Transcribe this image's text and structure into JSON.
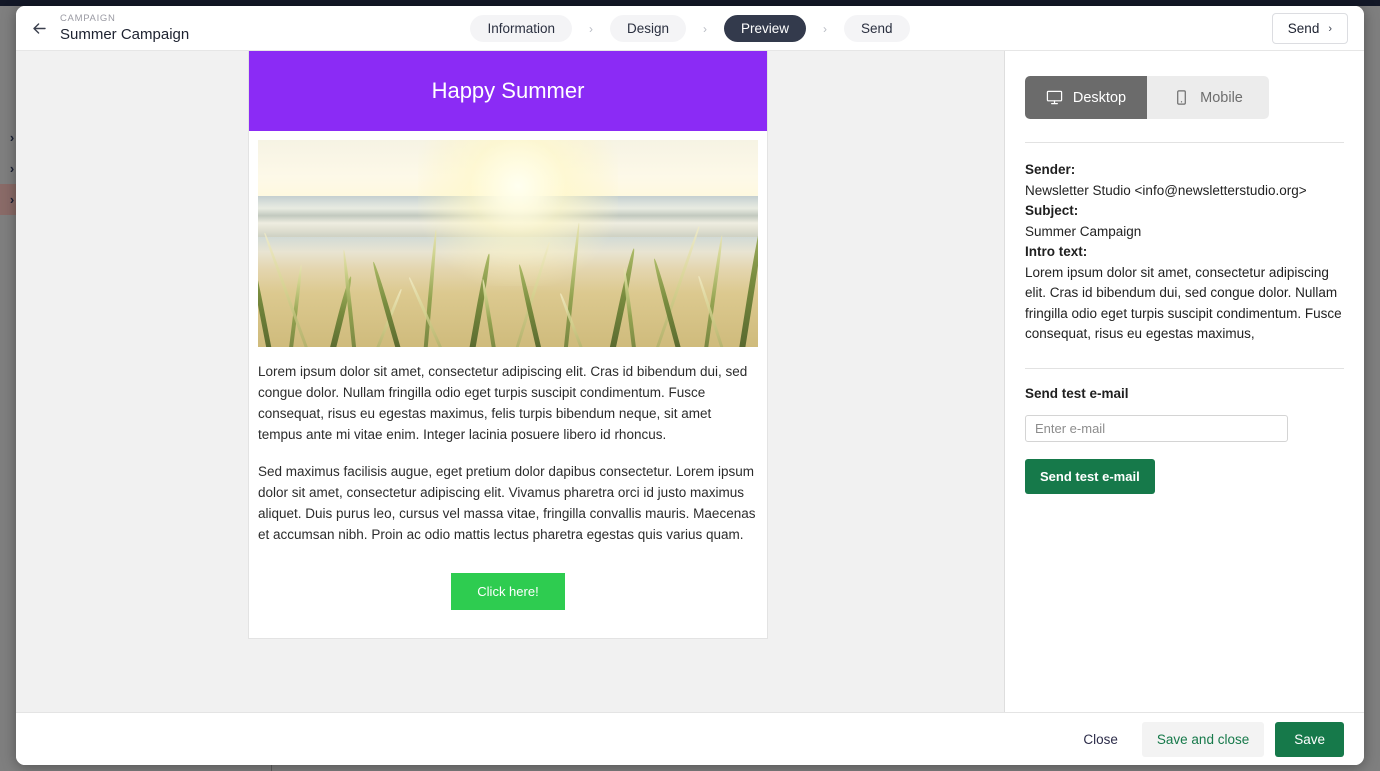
{
  "background": {
    "nav_chevrons": [
      "chevron-right-icon",
      "chevron-right-icon",
      "chevron-right-icon"
    ]
  },
  "header": {
    "back_icon": "arrow-left-icon",
    "kicker": "CAMPAIGN",
    "title": "Summer Campaign",
    "steps": [
      {
        "label": "Information",
        "active": false
      },
      {
        "label": "Design",
        "active": false
      },
      {
        "label": "Preview",
        "active": true
      },
      {
        "label": "Send",
        "active": false
      }
    ],
    "step_separator": "›",
    "send_button": {
      "label": "Send",
      "chevron": "›"
    }
  },
  "email_preview": {
    "banner_title": "Happy Summer",
    "banner_color": "#8b2bf5",
    "image_alt": "beach-sunset-dune-grass-photo",
    "paragraphs": [
      "Lorem ipsum dolor sit amet, consectetur adipiscing elit. Cras id bibendum dui, sed congue dolor. Nullam fringilla odio eget turpis suscipit condimentum. Fusce consequat, risus eu egestas maximus, felis turpis bibendum neque, sit amet tempus ante mi vitae enim. Integer lacinia posuere libero id rhoncus.",
      "Sed maximus facilisis augue, eget pretium dolor dapibus consectetur. Lorem ipsum dolor sit amet, consectetur adipiscing elit. Vivamus pharetra orci id justo maximus aliquet. Duis purus leo, cursus vel massa vitae, fringilla convallis mauris. Maecenas et accumsan nibh. Proin ac odio mattis lectus pharetra egestas quis varius quam."
    ],
    "cta_label": "Click here!",
    "cta_color": "#2ecc50"
  },
  "side_panel": {
    "device_toggle": [
      {
        "label": "Desktop",
        "icon": "monitor-icon",
        "active": true
      },
      {
        "label": "Mobile",
        "icon": "phone-icon",
        "active": false
      }
    ],
    "sender_label": "Sender:",
    "sender_value": "Newsletter Studio <info@newsletterstudio.org>",
    "subject_label": "Subject:",
    "subject_value": "Summer Campaign",
    "intro_label": "Intro text:",
    "intro_value": "Lorem ipsum dolor sit amet, consectetur adipiscing elit. Cras id bibendum dui, sed congue dolor. Nullam fringilla odio eget turpis suscipit condimentum. Fusce consequat, risus eu egestas maximus,",
    "send_test_title": "Send test e-mail",
    "email_placeholder": "Enter e-mail",
    "email_value": "",
    "send_test_button": "Send test e-mail"
  },
  "footer": {
    "close_label": "Close",
    "save_close_label": "Save and close",
    "save_label": "Save",
    "accent_green": "#16794a"
  }
}
